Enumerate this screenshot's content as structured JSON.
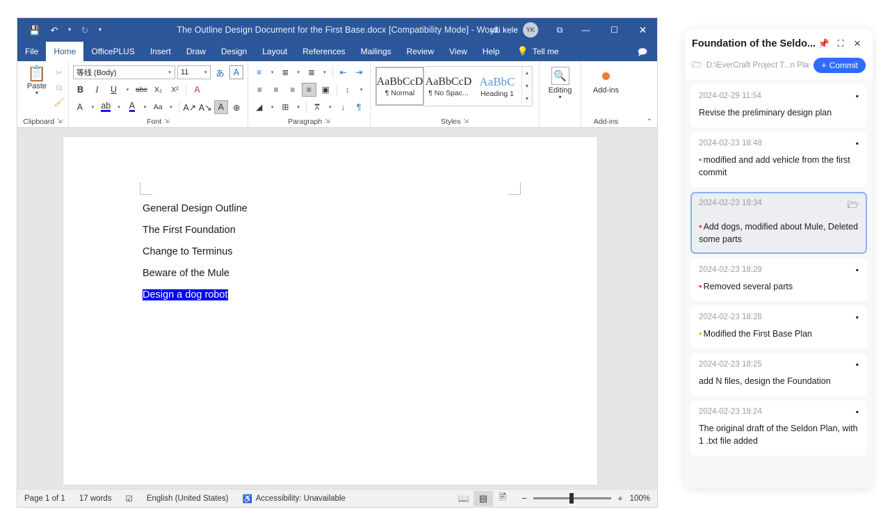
{
  "word": {
    "titlebar": {
      "document_title": "The Outline Design Document for the First Base.docx [Compatibility Mode]  -  Word",
      "user_name": "yiti kele",
      "avatar_initials": "YK",
      "qat": [
        {
          "name": "save-icon",
          "glyph": "⬜"
        },
        {
          "name": "undo-icon",
          "glyph": "↶"
        },
        {
          "name": "undo-dropdown-icon",
          "glyph": "⌄"
        },
        {
          "name": "redo-icon",
          "glyph": "↻"
        },
        {
          "name": "customize-qat-icon",
          "glyph": "⌄"
        }
      ],
      "ribbon_display_icon": "⧉",
      "minimize_icon": "—",
      "maximize_icon": "☐",
      "close_icon": "✕"
    },
    "tabs": [
      {
        "label": "File",
        "active": false
      },
      {
        "label": "Home",
        "active": true
      },
      {
        "label": "OfficePLUS",
        "active": false
      },
      {
        "label": "Insert",
        "active": false
      },
      {
        "label": "Draw",
        "active": false
      },
      {
        "label": "Design",
        "active": false
      },
      {
        "label": "Layout",
        "active": false
      },
      {
        "label": "References",
        "active": false
      },
      {
        "label": "Mailings",
        "active": false
      },
      {
        "label": "Review",
        "active": false
      },
      {
        "label": "View",
        "active": false
      },
      {
        "label": "Help",
        "active": false
      }
    ],
    "tell_me": {
      "label": "Tell me",
      "icon": "💡"
    },
    "comment_icon": "💬",
    "ribbon": {
      "clipboard": {
        "group_label": "Clipboard",
        "paste_label": "Paste",
        "paste_icon": "📋",
        "cut_icon": "✂",
        "copy_icon": "⧉",
        "format_painter_icon": "🖌",
        "launcher_icon": "↘"
      },
      "font": {
        "group_label": "Font",
        "font_name": "等线 (Body)",
        "font_size": "11",
        "phonetic_guide_icon": "あ",
        "character_border_icon": "A",
        "bold": "B",
        "italic": "I",
        "underline": "U",
        "strikethrough": "abc",
        "subscript": "X₂",
        "superscript": "X²",
        "clear_formatting_icon": "A",
        "text_effects_icon": "A",
        "highlight_icon": "ab",
        "font_color_icon": "A",
        "change_case_icon": "Aa",
        "grow_font_icon": "A",
        "shrink_font_icon": "A",
        "char_shading_icon": "A",
        "enclose_char_icon": "⊕",
        "launcher_icon": "↘"
      },
      "paragraph": {
        "group_label": "Paragraph",
        "bullets_icon": "≡",
        "numbering_icon": "≡",
        "multilevel_icon": "≡",
        "decrease_indent_icon": "←",
        "increase_indent_icon": "→",
        "align_left_icon": "≡",
        "align_center_icon": "≡",
        "align_right_icon": "≡",
        "justify_icon": "≡",
        "distributed_icon": "⌸",
        "line_spacing_icon": "⇅",
        "shading_icon": "◢",
        "borders_icon": "⊞",
        "asian_layout_icon": "⩞",
        "sort_icon": "↓",
        "show_marks_icon": "¶",
        "launcher_icon": "↘"
      },
      "styles": {
        "group_label": "Styles",
        "launcher_icon": "↘",
        "items": [
          {
            "preview": "AaBbCcD",
            "name": "¶ Normal",
            "selected": true
          },
          {
            "preview": "AaBbCcD",
            "name": "¶ No Spac...",
            "selected": false
          },
          {
            "preview": "AaBbC",
            "name": "Heading 1",
            "selected": false
          }
        ],
        "scroll_up_icon": "▴",
        "scroll_down_icon": "▾",
        "more_icon": "▾"
      },
      "editing": {
        "label": "Editing",
        "icon": "🔍",
        "caret": "⌄"
      },
      "addins": {
        "label": "Add-ins",
        "group_label": "Add-ins"
      },
      "collapse_icon": "⌃"
    },
    "document": {
      "lines": [
        {
          "text": "General Design Outline",
          "selected": false
        },
        {
          "text": "The First Foundation",
          "selected": false
        },
        {
          "text": "Change to Terminus",
          "selected": false
        },
        {
          "text": "Beware of the Mule",
          "selected": false
        },
        {
          "text": "Design a dog robot",
          "selected": true
        }
      ],
      "selection_color": "#0000ff"
    },
    "statusbar": {
      "page": "Page 1 of 1",
      "words": "17 words",
      "proofing_icon": "☑",
      "language": "English (United States)",
      "accessibility_icon": "♿",
      "accessibility": "Accessibility: Unavailable",
      "view_read_icon": "📖",
      "view_print_icon": "⌸",
      "view_web_icon": "🌐",
      "zoom_out": "−",
      "zoom_in": "+",
      "zoom_level": "100%"
    }
  },
  "panel": {
    "title": "Foundation of the Seldo...",
    "pin_icon": "📌",
    "expand_icon": "⛶",
    "close_icon": "✕",
    "folder_icon": "🗁",
    "path": "D:\\EverCraft Project T...n Plan",
    "commit_button": "Commit",
    "commit_plus": "+",
    "menu_icon": "▪",
    "folder_open_icon": "🗁",
    "commits": [
      {
        "time": "2024-02-29 11:54",
        "message": "Revise the preliminary design plan",
        "bullet_color": null,
        "selected": false
      },
      {
        "time": "2024-02-23 18:48",
        "message": "modified and add vehicle from the first commit",
        "bullet_color": "#22b573",
        "selected": false
      },
      {
        "time": "2024-02-23 18:34",
        "message": "Add dogs, modified about Mule, Deleted some parts",
        "bullet_color": "#e8372c",
        "selected": true
      },
      {
        "time": "2024-02-23 18:29",
        "message": "Removed several parts",
        "bullet_color": "#e8372c",
        "selected": false
      },
      {
        "time": "2024-02-23 18:28",
        "message": "Modified the First Base Plan",
        "bullet_color": "#f5a623",
        "selected": false
      },
      {
        "time": "2024-02-23 18:25",
        "message": "add N files, design the Foundation",
        "bullet_color": null,
        "selected": false
      },
      {
        "time": "2024-02-23 18:24",
        "message": "The original draft of the Seldon Plan, with 1 .txt file added",
        "bullet_color": null,
        "selected": false
      }
    ]
  }
}
